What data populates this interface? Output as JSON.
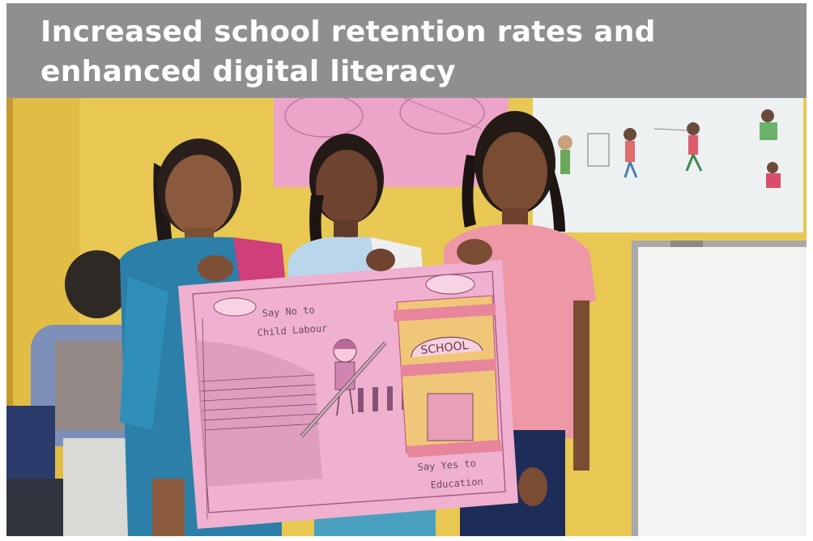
{
  "headline": {
    "line1": "Increased school retention rates and",
    "line2": "enhanced digital literacy"
  },
  "poster": {
    "left_slogan_line1": "Say No to",
    "left_slogan_line2": "Child Labour",
    "school_sign": "SCHOOL",
    "right_slogan_line1": "Say Yes to",
    "right_slogan_line2": "Education"
  },
  "colors": {
    "banner": "#8e8f91",
    "banner_text": "#ffffff",
    "wall": "#e6c64f",
    "poster": "#eeb0cf"
  }
}
